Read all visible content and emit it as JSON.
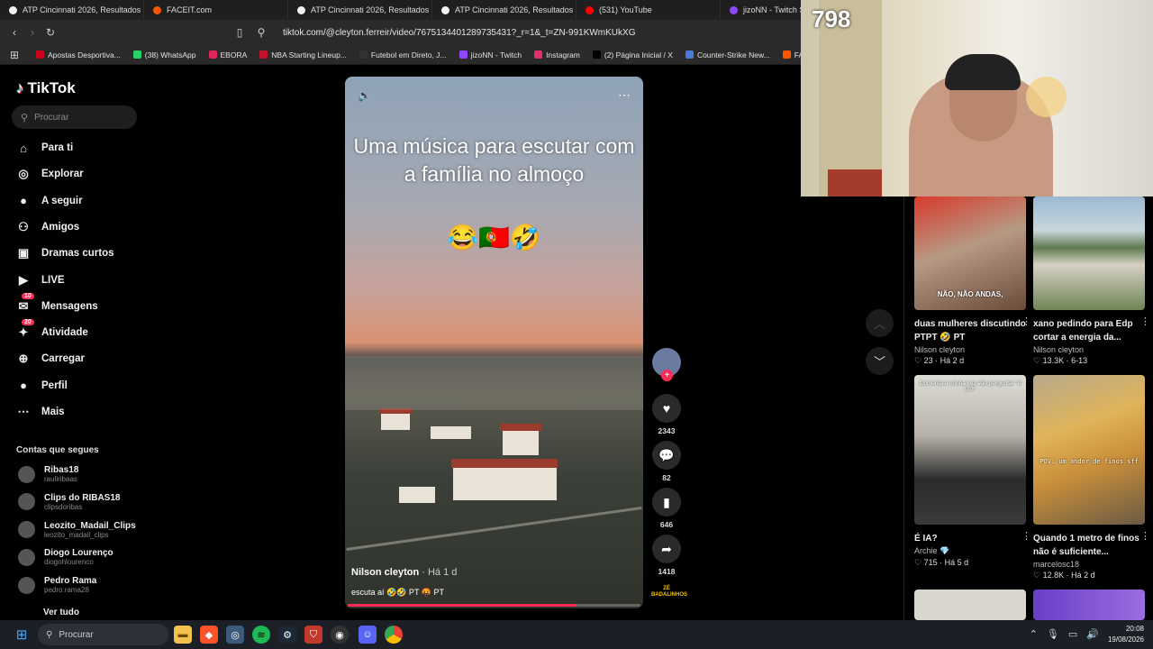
{
  "browser": {
    "tabs": [
      {
        "label": "ATP Cincinnati 2026, Resultados de",
        "color": "#f2f2f2"
      },
      {
        "label": "FACEIT.com",
        "color": "#ff5500"
      },
      {
        "label": "ATP Cincinnati 2026, Resultados de",
        "color": "#f2f2f2"
      },
      {
        "label": "ATP Cincinnati 2026, Resultados de",
        "color": "#f2f2f2"
      },
      {
        "label": "(531) YouTube",
        "color": "#ff0000"
      },
      {
        "label": "jizoNN - Twitch St",
        "color": "#9146ff"
      }
    ],
    "url": "tiktok.com/@cleyton.ferreir/video/7675134401289735431?_r=1&_t=ZN-991KWmKUkXG",
    "bookmarks": [
      {
        "label": "Apostas Desportiva...",
        "color": "#d0021b"
      },
      {
        "label": "(38) WhatsApp",
        "color": "#25d366"
      },
      {
        "label": "EBORA",
        "color": "#e0245e"
      },
      {
        "label": "NBA Starting Lineup...",
        "color": "#c8102e"
      },
      {
        "label": "Futebol em Direto, J...",
        "color": "#333333"
      },
      {
        "label": "jizoNN - Twitch",
        "color": "#9146ff"
      },
      {
        "label": "Instagram",
        "color": "#e1306c"
      },
      {
        "label": "(2) Página Inicial / X",
        "color": "#000000"
      },
      {
        "label": "Counter-Strike New...",
        "color": "#4b7bd6"
      },
      {
        "label": "FACEIT.com",
        "color": "#ff5500"
      }
    ]
  },
  "tiktok": {
    "logo": "TikTok",
    "search_placeholder": "Procurar",
    "nav": [
      {
        "label": "Para ti",
        "icon": "home-icon"
      },
      {
        "label": "Explorar",
        "icon": "compass-icon"
      },
      {
        "label": "A seguir",
        "icon": "following-icon"
      },
      {
        "label": "Amigos",
        "icon": "friends-icon"
      },
      {
        "label": "Dramas curtos",
        "icon": "dramas-icon"
      },
      {
        "label": "LIVE",
        "icon": "live-icon"
      },
      {
        "label": "Mensagens",
        "icon": "messages-icon",
        "badge": "10"
      },
      {
        "label": "Atividade",
        "icon": "activity-icon",
        "badge": "20"
      },
      {
        "label": "Carregar",
        "icon": "upload-icon"
      },
      {
        "label": "Perfil",
        "icon": "profile-icon"
      },
      {
        "label": "Mais",
        "icon": "more-icon"
      }
    ],
    "following_title": "Contas que segues",
    "following": [
      {
        "name": "Ribas18",
        "handle": "rauliribaas"
      },
      {
        "name": "Clips do RIBAS18",
        "handle": "clipsdoribas"
      },
      {
        "name": "Leozito_Madail_Clips",
        "handle": "leozito_madail_clips"
      },
      {
        "name": "Diogo Lourenço",
        "handle": "diogohlourenco"
      },
      {
        "name": "Pedro Rama",
        "handle": "pedro.rama28"
      }
    ],
    "see_all": "Ver tudo"
  },
  "video": {
    "overlay_text": "Uma música para escutar com a família no almoço",
    "emojis": "😂🇵🇹🤣",
    "author": "Nilson cleyton",
    "time": " · Há 1 d",
    "description": "escuta aí 🤣🤣 PT 🤬 PT",
    "progress": 0.78,
    "likes": "2343",
    "comments": "82",
    "saves": "646",
    "shares": "1418",
    "music_badge": "ZÉ BADALINHOS"
  },
  "grid": [
    {
      "title": "duas mulheres discutindo PTPT 🤣 PT",
      "author": "Nilson cleyton",
      "likes": "23",
      "time": "Há 2 d",
      "overlay": "NÃO, NÃO ANDAS,"
    },
    {
      "title": "xano pedindo para Edp cortar a energia da...",
      "author": "Nilson cleyton",
      "likes": "13.3K",
      "time": "6-13",
      "overlay": ""
    },
    {
      "title": "É IA?",
      "author": "Archie 💎",
      "likes": "715",
      "time": "Há 5 d",
      "overlay": "Comenta a minha vez vão perguntar \"é IA?\""
    },
    {
      "title": "Quando 1 metro de finos não é suficiente...",
      "author": "marcelosc18",
      "likes": "12.8K",
      "time": "Há 2 d",
      "overlay": "POV: um andor de finos sff"
    }
  ],
  "stream": {
    "viewers": "798"
  },
  "taskbar": {
    "search_placeholder": "Procurar",
    "time": "20:08",
    "date": "19/08/2026"
  }
}
